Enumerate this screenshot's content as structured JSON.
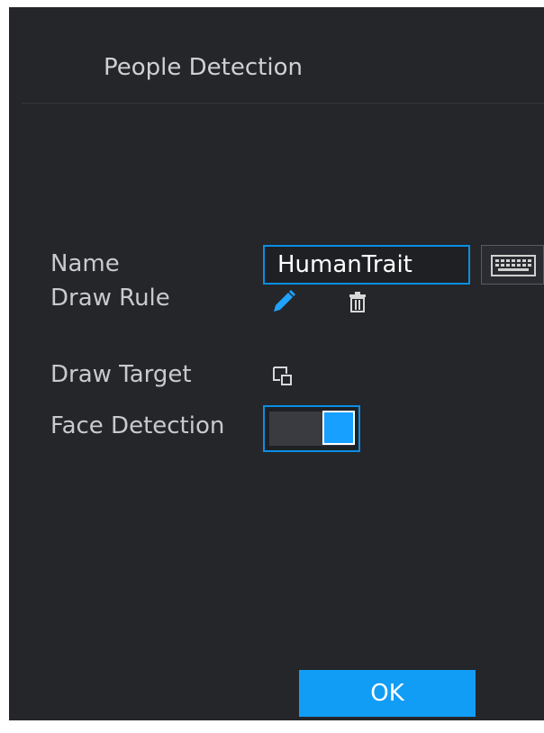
{
  "dialog": {
    "title": "People Detection",
    "fields": {
      "name_label": "Name",
      "name_value": "HumanTrait",
      "draw_rule_label": "Draw Rule",
      "draw_target_label": "Draw Target",
      "face_detection_label": "Face Detection",
      "face_detection_enabled": true
    },
    "icons": {
      "keyboard": "keyboard-icon",
      "draw_rule_edit": "pencil-icon",
      "draw_rule_delete": "trash-icon",
      "draw_target": "draw-target-icon"
    },
    "ok_label": "OK"
  },
  "colors": {
    "panel_bg": "#25262a",
    "accent": "#0a8fe3",
    "button": "#119cf5",
    "text": "#c9cacc"
  }
}
